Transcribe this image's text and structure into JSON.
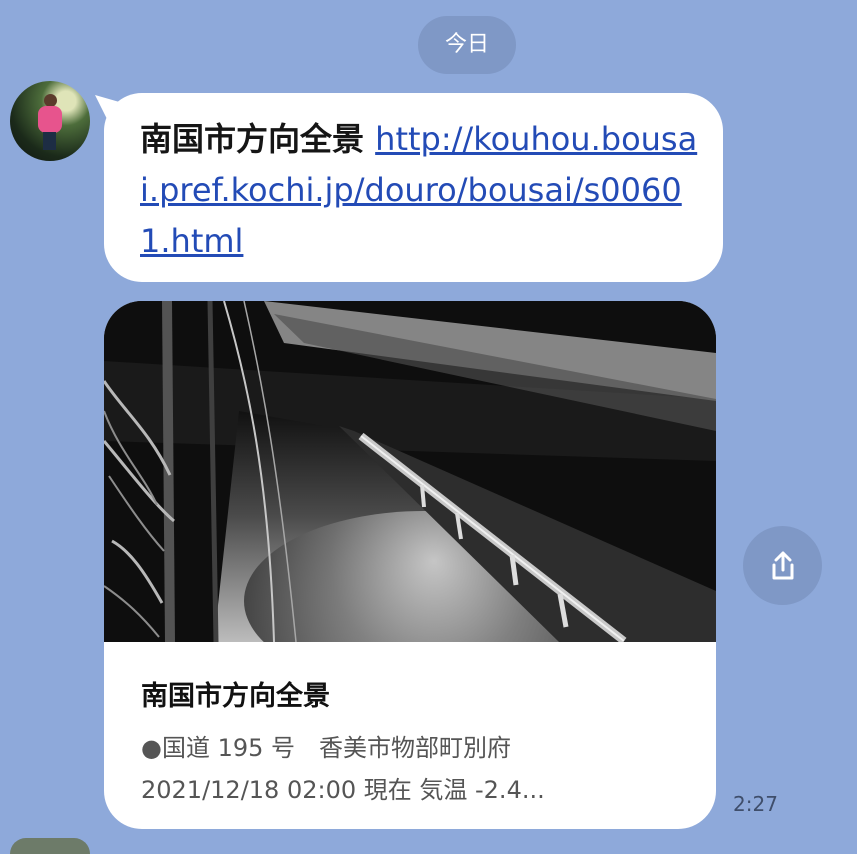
{
  "chat": {
    "date_label": "今日",
    "message": {
      "title": "南国市方向全景",
      "link_text": "http://kouhou.bousai.pref.kochi.jp/douro/bousai/s00601.html"
    },
    "card": {
      "title": "南国市方向全景",
      "line1": "●国道 195 号　香美市物部町別府",
      "line2": "2021/12/18 02:00 現在 気温 -2.4..."
    },
    "time": "2:27"
  },
  "icons": {
    "share": "share-icon"
  }
}
